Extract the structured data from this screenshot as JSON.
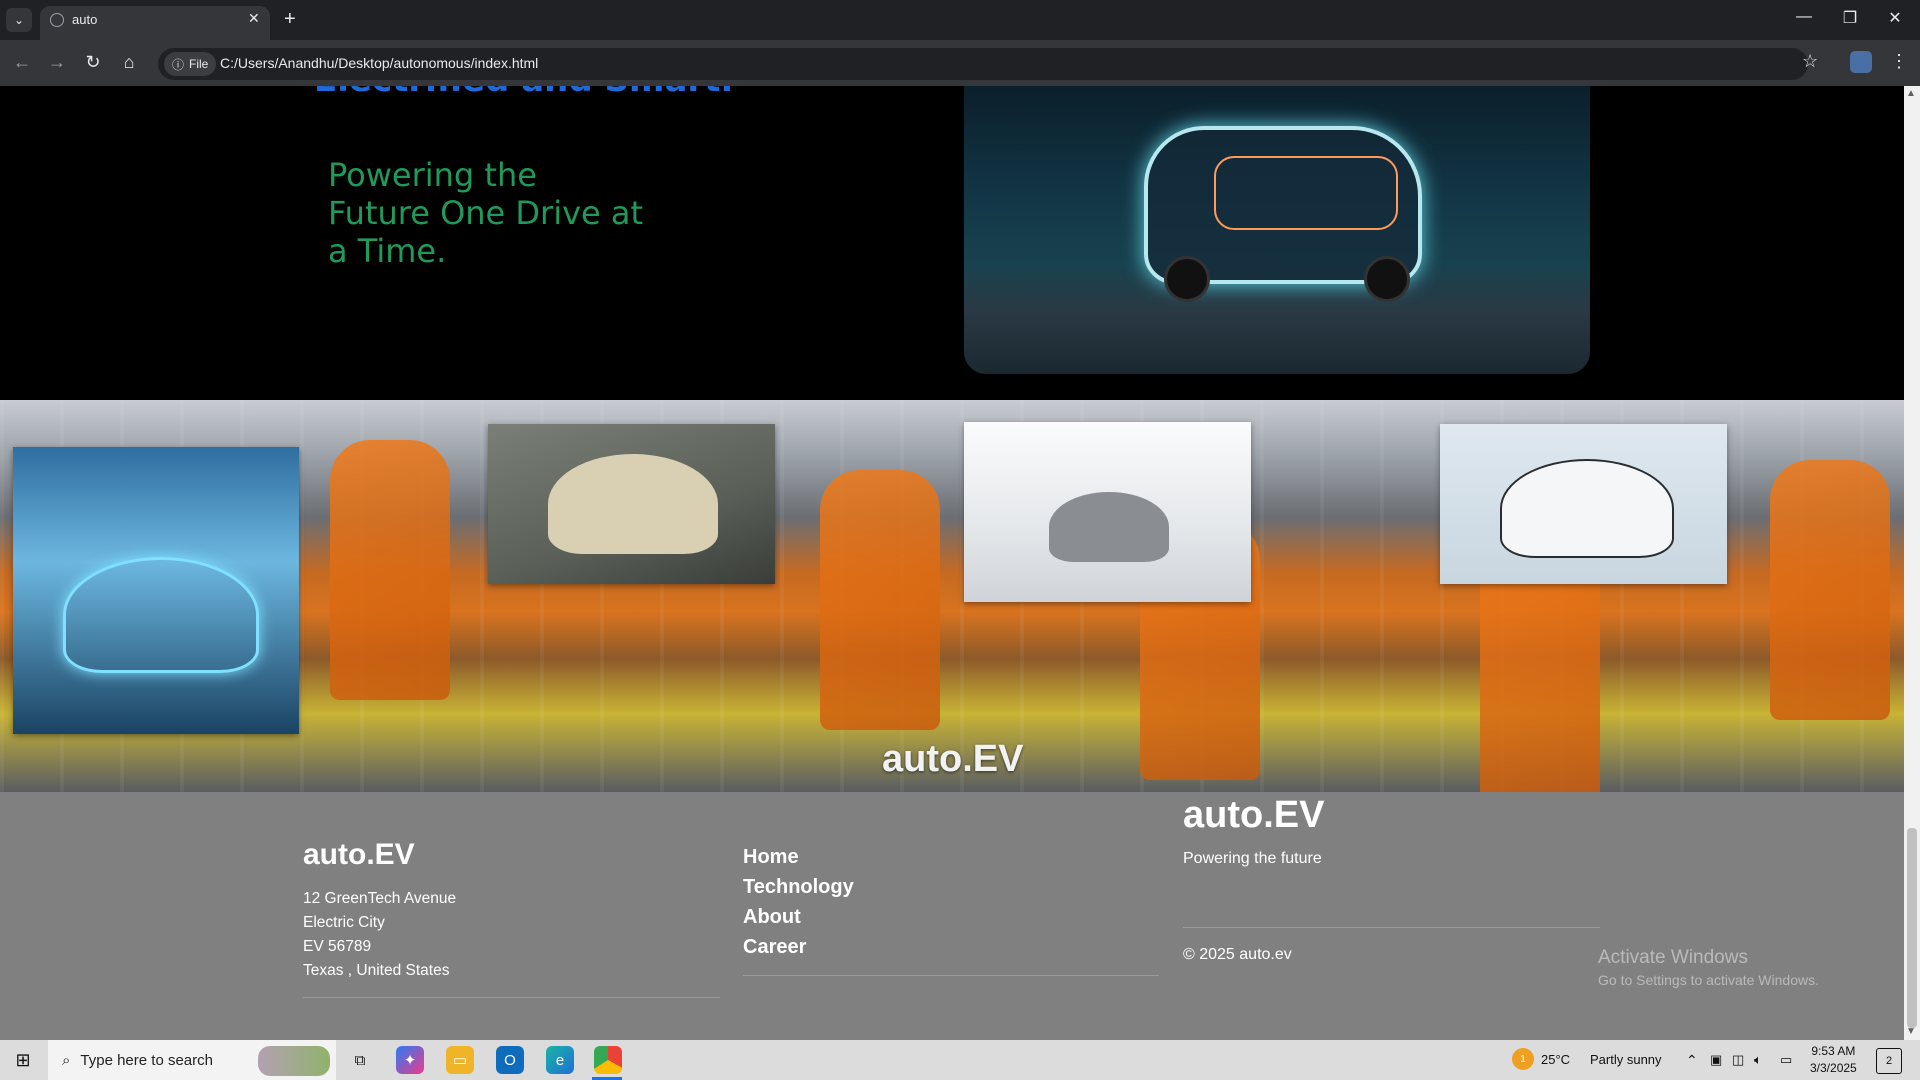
{
  "browser": {
    "tab_title": "auto",
    "file_chip": "File",
    "url": "C:/Users/Anandhu/Desktop/autonomous/index.html",
    "icons": {
      "tab_list": "chevron-down-icon",
      "new_tab": "plus-icon",
      "back": "back-arrow-icon",
      "forward": "forward-arrow-icon",
      "reload": "reload-icon",
      "home": "home-icon",
      "info": "info-icon",
      "bookmark": "star-icon",
      "menu": "kebab-menu-icon"
    }
  },
  "hero": {
    "headline": "Electrified and Smart.",
    "tagline": "Powering the Future One Drive at a Time."
  },
  "gallery": {
    "title": "auto.EV"
  },
  "footer": {
    "brand": "auto.EV",
    "address": [
      "12 GreenTech Avenue",
      "Electric City",
      "EV 56789",
      "Texas , United States"
    ],
    "links": [
      "Home",
      "Technology",
      "About",
      "Career"
    ],
    "brand_large": "auto.EV",
    "tagline": "Powering the future",
    "copyright": "© 2025 auto.ev"
  },
  "watermark": {
    "line1": "Activate Windows",
    "line2": "Go to Settings to activate Windows."
  },
  "taskbar": {
    "search_placeholder": "Type here to search",
    "weather_temp": "25°C",
    "weather_desc": "Partly sunny",
    "time": "9:53 AM",
    "date": "3/3/2025",
    "notification_count": "2",
    "weather_badge": "1"
  },
  "colors": {
    "headline": "#1e6ad8",
    "tagline": "#1f9a5a",
    "footer_bg": "#808080"
  }
}
